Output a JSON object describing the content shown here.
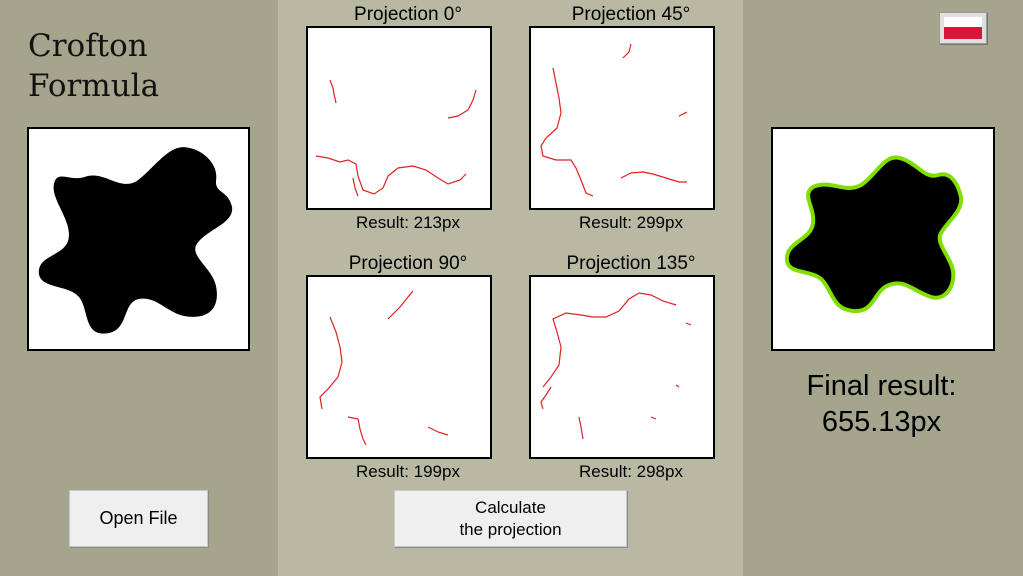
{
  "app": {
    "title": "Crofton\nFormula"
  },
  "projections": [
    {
      "title": "Projection 0°",
      "result": "Result: 213px"
    },
    {
      "title": "Projection 45°",
      "result": "Result: 299px"
    },
    {
      "title": "Projection 90°",
      "result": "Result: 199px"
    },
    {
      "title": "Projection 135°",
      "result": "Result: 298px"
    }
  ],
  "buttons": {
    "open_file": "Open File",
    "calculate": "Calculate\nthe projection"
  },
  "final": {
    "label": "Final result:",
    "value": "655.13px"
  },
  "language": {
    "icon": "poland-flag-icon"
  },
  "colors": {
    "side_panel": "#a5a58d",
    "center_panel": "#b8b8a3",
    "projection_line": "#e02020",
    "contour": "#7fe000",
    "shape": "#000000"
  }
}
